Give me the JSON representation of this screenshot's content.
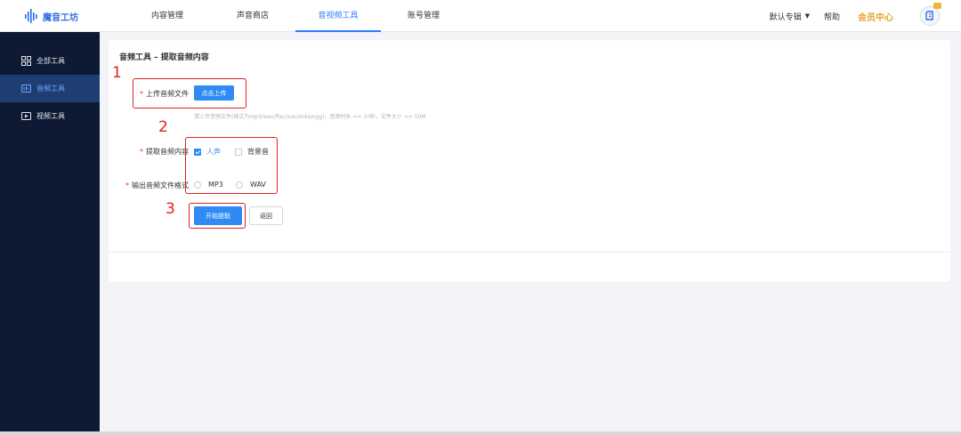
{
  "header": {
    "logo_text": "魔音工坊",
    "nav": [
      "内容管理",
      "声音商店",
      "音视频工具",
      "账号管理"
    ],
    "active_nav": "音视频工具",
    "album_label": "默认专辑",
    "help_label": "帮助",
    "vip_label": "会员中心"
  },
  "sidebar": {
    "items": [
      {
        "label": "全部工具",
        "icon": "grid-icon"
      },
      {
        "label": "音频工具",
        "icon": "audio-icon",
        "active": true
      },
      {
        "label": "视频工具",
        "icon": "video-icon"
      }
    ]
  },
  "main": {
    "title": "音频工具 – 提取音频内容",
    "upload": {
      "label": "上传音频文件",
      "button": "点击上传",
      "hint": "请上传音频文件(格式为mp3/wav/flac/aac/m4a/ogg)，音频时长 <= 10秒，文件大小 <= 50M"
    },
    "extract": {
      "label": "提取音频内容",
      "options": [
        {
          "label": "人声",
          "checked": true
        },
        {
          "label": "背景音",
          "checked": false
        }
      ]
    },
    "format": {
      "label": "输出音频文件格式",
      "options": [
        "MP3",
        "WAV"
      ]
    },
    "start_button": "开始提取",
    "back_button": "返回"
  },
  "annotations": [
    "1",
    "2",
    "3"
  ],
  "colors": {
    "accent": "#2f8bf3",
    "sidebar_bg": "#0e1a33",
    "annotation": "#e02020",
    "vip": "#e6a22a"
  }
}
